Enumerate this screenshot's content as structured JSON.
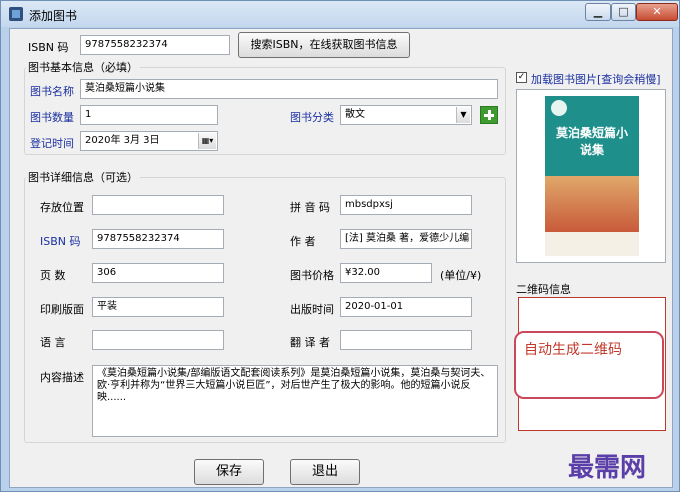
{
  "window": {
    "title": "添加图书",
    "min_glyph": "▁",
    "max_glyph": "□",
    "close_glyph": "✕"
  },
  "isbn_top": {
    "label": "ISBN  码",
    "value": "9787558232374",
    "search_button": "搜索ISBN，在线获取图书信息"
  },
  "basic": {
    "section_title": "图书基本信息（必填）",
    "name_label": "图书名称",
    "name_value": "莫泊桑短篇小说集",
    "qty_label": "图书数量",
    "qty_value": "1",
    "category_label": "图书分类",
    "category_value": "散文",
    "date_label": "登记时间",
    "date_value": "2020年  3月  3日"
  },
  "detail": {
    "section_title": "图书详细信息（可选）",
    "location_label": "存放位置",
    "location_value": "",
    "pinyin_label": "拼 音 码",
    "pinyin_value": "mbsdpxsj",
    "isbn_label": "ISBN  码",
    "isbn_value": "9787558232374",
    "author_label": "作     者",
    "author_value": "[法] 莫泊桑 著，爱德少儿编",
    "pages_label": "页     数",
    "pages_value": "306",
    "price_label": "图书价格",
    "price_value": "¥32.00",
    "price_unit": "(单位/¥)",
    "format_label": "印刷版面",
    "format_value": "平装",
    "pubdate_label": "出版时间",
    "pubdate_value": "2020-01-01",
    "language_label": "语     言",
    "language_value": "",
    "translator_label": "翻 译 者",
    "translator_value": "",
    "desc_label": "内容描述",
    "desc_value": "《莫泊桑短篇小说集/部编版语文配套阅读系列》是莫泊桑短篇小说集，莫泊桑与契诃夫、欧·亨利并称为“世界三大短篇小说巨匠”，对后世产生了极大的影响。他的短篇小说反映......"
  },
  "right": {
    "load_cover_label": "加载图书图片[查询会稍慢]",
    "load_cover_checked": true,
    "cover_title": "莫泊桑短篇小说集",
    "qr_section_label": "二维码信息",
    "qr_bubble": "自动生成二维码"
  },
  "footer": {
    "save_button": "保存",
    "exit_button": "退出"
  },
  "watermark": "最需网",
  "colors": {
    "blue_label": "#1a2fa0",
    "accent_red": "#c0392b",
    "cover_teal": "#1f8f8b"
  }
}
